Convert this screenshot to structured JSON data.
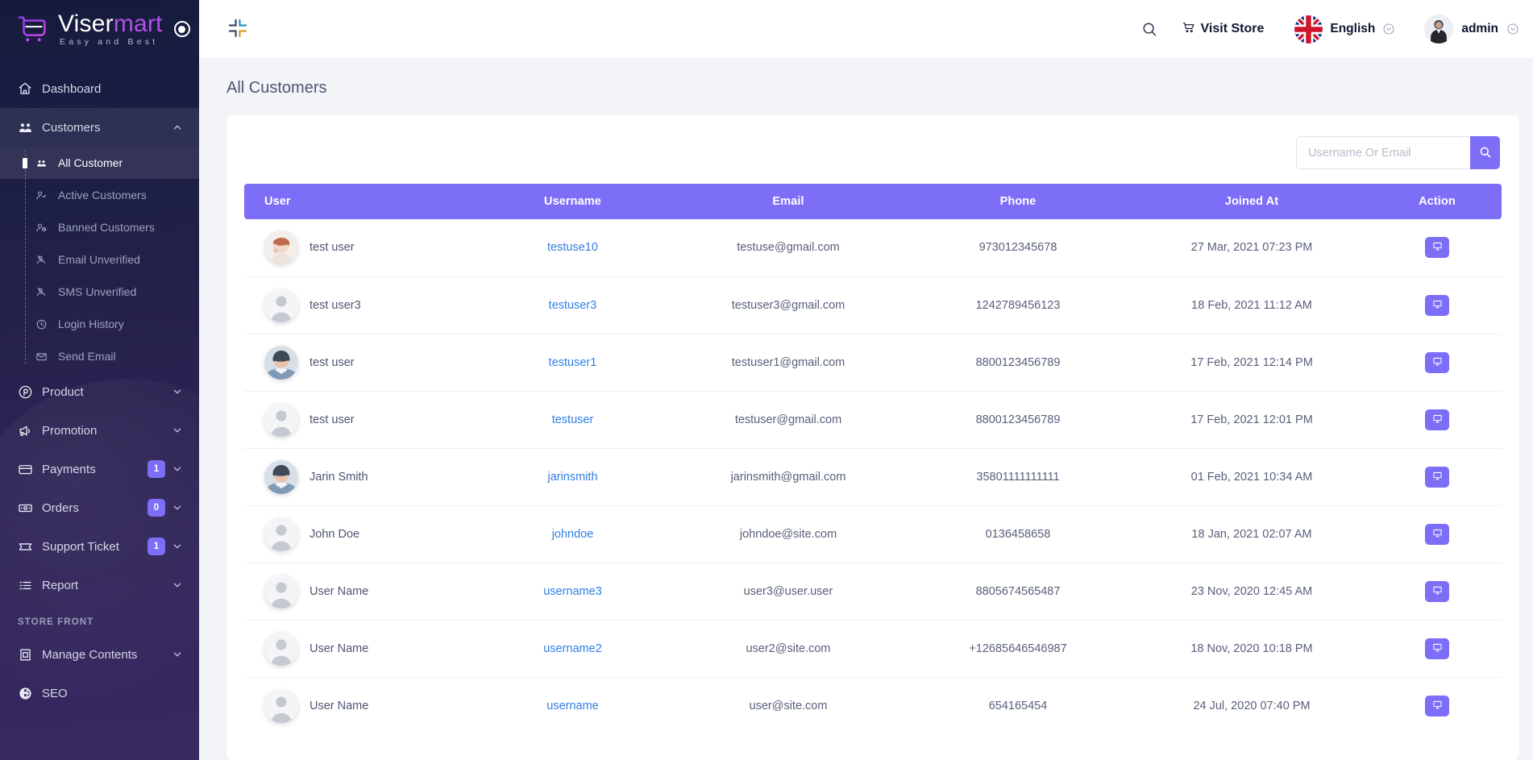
{
  "brand": {
    "name_part1": "Viser",
    "name_part2": "mart",
    "tagline": "Easy and Best"
  },
  "sidebar": {
    "items": [
      {
        "label": "Dashboard",
        "icon": "home-icon",
        "badge": null,
        "caret": false
      },
      {
        "label": "Customers",
        "icon": "users-icon",
        "badge": null,
        "caret": true
      },
      {
        "label": "Product",
        "icon": "product-icon",
        "badge": null,
        "caret": true
      },
      {
        "label": "Promotion",
        "icon": "megaphone-icon",
        "badge": null,
        "caret": true
      },
      {
        "label": "Payments",
        "icon": "credit-card-icon",
        "badge": "1",
        "caret": true
      },
      {
        "label": "Orders",
        "icon": "orders-icon",
        "badge": "0",
        "caret": true
      },
      {
        "label": "Support Ticket",
        "icon": "ticket-icon",
        "badge": "1",
        "caret": true
      },
      {
        "label": "Report",
        "icon": "report-icon",
        "badge": null,
        "caret": true
      }
    ],
    "customers_submenu": [
      {
        "label": "All Customer",
        "icon": "users-small-icon",
        "active": true
      },
      {
        "label": "Active Customers",
        "icon": "user-check-icon",
        "active": false
      },
      {
        "label": "Banned Customers",
        "icon": "user-ban-icon",
        "active": false
      },
      {
        "label": "Email Unverified",
        "icon": "user-email-off-icon",
        "active": false
      },
      {
        "label": "SMS Unverified",
        "icon": "user-sms-off-icon",
        "active": false
      },
      {
        "label": "Login History",
        "icon": "clock-icon",
        "active": false
      },
      {
        "label": "Send Email",
        "icon": "envelope-icon",
        "active": false
      }
    ],
    "section_title": "STORE FRONT",
    "storefront_items": [
      {
        "label": "Manage Contents",
        "icon": "contents-icon",
        "caret": true
      },
      {
        "label": "SEO",
        "icon": "globe-icon",
        "caret": false
      }
    ]
  },
  "topbar": {
    "collapse_icon": "collapse-icon",
    "search_icon": "search-icon",
    "visit_store": "Visit Store",
    "language": "English",
    "username": "admin"
  },
  "page": {
    "title": "All Customers"
  },
  "search": {
    "placeholder": "Username Or Email",
    "value": "",
    "button_icon": "search-icon"
  },
  "table": {
    "columns": [
      "User",
      "Username",
      "Email",
      "Phone",
      "Joined At",
      "Action"
    ],
    "rows": [
      {
        "user": "test user",
        "username": "testuse10",
        "email": "testuse@gmail.com",
        "phone": "973012345678",
        "joined": "27 Mar, 2021 07:23 PM",
        "avatar": "photo-female-1",
        "action_icon": "monitor-icon"
      },
      {
        "user": "test user3",
        "username": "testuser3",
        "email": "testuser3@gmail.com",
        "phone": "1242789456123",
        "joined": "18 Feb, 2021 11:12 AM",
        "avatar": "placeholder",
        "action_icon": "monitor-icon"
      },
      {
        "user": "test user",
        "username": "testuser1",
        "email": "testuser1@gmail.com",
        "phone": "8800123456789",
        "joined": "17 Feb, 2021 12:14 PM",
        "avatar": "photo-female-2",
        "action_icon": "monitor-icon"
      },
      {
        "user": "test user",
        "username": "testuser",
        "email": "testuser@gmail.com",
        "phone": "8800123456789",
        "joined": "17 Feb, 2021 12:01 PM",
        "avatar": "placeholder",
        "action_icon": "monitor-icon"
      },
      {
        "user": "Jarin Smith",
        "username": "jarinsmith",
        "email": "jarinsmith@gmail.com",
        "phone": "35801111111111",
        "joined": "01 Feb, 2021 10:34 AM",
        "avatar": "photo-female-2",
        "action_icon": "monitor-icon"
      },
      {
        "user": "John Doe",
        "username": "johndoe",
        "email": "johndoe@site.com",
        "phone": "0136458658",
        "joined": "18 Jan, 2021 02:07 AM",
        "avatar": "placeholder",
        "action_icon": "monitor-icon"
      },
      {
        "user": "User Name",
        "username": "username3",
        "email": "user3@user.user",
        "phone": "8805674565487",
        "joined": "23 Nov, 2020 12:45 AM",
        "avatar": "placeholder",
        "action_icon": "monitor-icon"
      },
      {
        "user": "User Name",
        "username": "username2",
        "email": "user2@site.com",
        "phone": "+12685646546987",
        "joined": "18 Nov, 2020 10:18 PM",
        "avatar": "placeholder",
        "action_icon": "monitor-icon"
      },
      {
        "user": "User Name",
        "username": "username",
        "email": "user@site.com",
        "phone": "654165454",
        "joined": "24 Jul, 2020 07:40 PM",
        "avatar": "placeholder",
        "action_icon": "monitor-icon"
      }
    ]
  },
  "colors": {
    "accent": "#7c6ef6",
    "link": "#2f7fe4",
    "sidebar_top": "#161b3d",
    "sidebar_bottom": "#382a61",
    "brand_purple": "#b14fe8"
  }
}
